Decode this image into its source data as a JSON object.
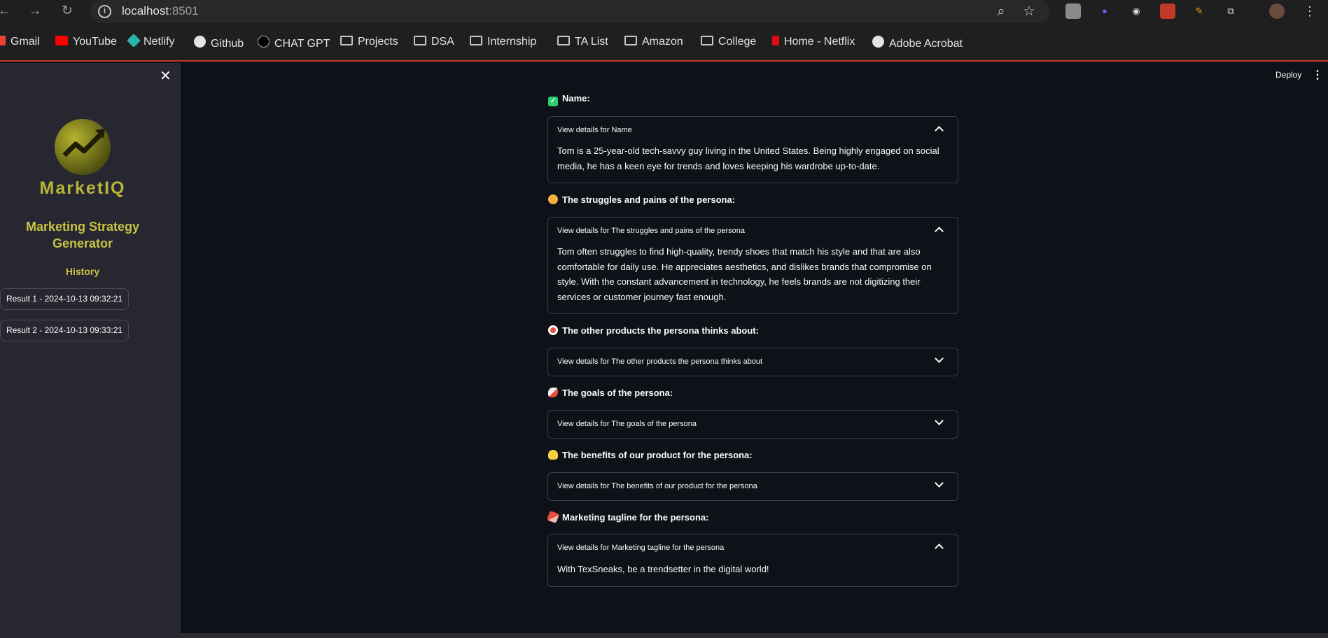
{
  "browser": {
    "url_host": "localhost",
    "url_port": ":8501",
    "bookmarks": [
      "Gmail",
      "YouTube",
      "Netlify",
      "Github",
      "CHAT GPT",
      "Projects",
      "DSA",
      "Internship",
      "TA List",
      "Amazon",
      "College",
      "Home - Netflix",
      "Adobe Acrobat"
    ]
  },
  "sidebar": {
    "logo_text": "MarketIQ",
    "app_title": "Marketing Strategy Generator",
    "history_label": "History",
    "history_items": [
      "Result 1 - 2024-10-13 09:32:21",
      "Result 2 - 2024-10-13 09:33:21"
    ]
  },
  "toolbar": {
    "deploy_label": "Deploy"
  },
  "sections": [
    {
      "heading": "Name:",
      "icon": "check-mark-icon",
      "icon_color": "#2ecc71",
      "expander_label": "View details for Name",
      "expanded": true,
      "body": "Tom is a 25-year-old tech-savvy guy living in the United States. Being highly engaged on social media, he has a keen eye for trends and loves keeping his wardrobe up-to-date."
    },
    {
      "heading": "The struggles and pains of the persona:",
      "icon": "thinking-face-icon",
      "icon_color": "#f5b041",
      "expander_label": "View details for The struggles and pains of the persona",
      "expanded": true,
      "body": "Tom often struggles to find high-quality, trendy shoes that match his style and that are also comfortable for daily use. He appreciates aesthetics, and dislikes brands that compromise on style. With the constant advancement in technology, he feels brands are not digitizing their services or customer journey fast enough."
    },
    {
      "heading": "The other products the persona thinks about:",
      "icon": "target-icon",
      "icon_color": "#e74c3c",
      "expander_label": "View details for The other products the persona thinks about",
      "expanded": false
    },
    {
      "heading": "The goals of the persona:",
      "icon": "rocket-icon",
      "icon_color": "#e74c3c",
      "expander_label": "View details for The goals of the persona",
      "expanded": false
    },
    {
      "heading": "The benefits of our product for the persona:",
      "icon": "light-bulb-icon",
      "icon_color": "#f4d03f",
      "expander_label": "View details for The benefits of our product for the persona",
      "expanded": false
    },
    {
      "heading": "Marketing tagline for the persona:",
      "icon": "lipstick-icon",
      "icon_color": "#e74c3c",
      "expander_label": "View details for Marketing tagline for the persona",
      "expanded": true,
      "body": "With TexSneaks, be a trendsetter in the digital world!"
    }
  ]
}
